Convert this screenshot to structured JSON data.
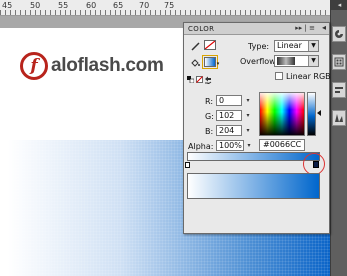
{
  "ruler": {
    "labels": [
      "45",
      "50",
      "55",
      "60",
      "65",
      "70",
      "75"
    ]
  },
  "logo": {
    "mark": "f",
    "text": "aloflash.com"
  },
  "panel": {
    "title": "COLOR",
    "menu_glyph": "▸▸ | ≡",
    "collapse_glyph": "◂",
    "type_label": "Type:",
    "type_value": "Linear",
    "overflow_label": "Overflow:",
    "linear_rgb_label": "Linear RGB",
    "linear_rgb_checked": false,
    "r_label": "R:",
    "r_value": "0",
    "g_label": "G:",
    "g_value": "102",
    "b_label": "B:",
    "b_value": "204",
    "alpha_label": "Alpha:",
    "alpha_value": "100%",
    "hex_value": "#0066CC"
  },
  "dock": {
    "top_glyph": "◂"
  },
  "colors": {
    "selected_color": "#0066CC",
    "gradient_start": "#FFFFFF",
    "highlight_circle": "#DD3333"
  },
  "icons": {
    "stroke_color_tool": "pencil-icon",
    "fill_color_tool": "paint-bucket-icon",
    "black_white": "black-white-icon",
    "no_color": "no-color-icon",
    "swap_colors": "swap-colors-icon"
  }
}
